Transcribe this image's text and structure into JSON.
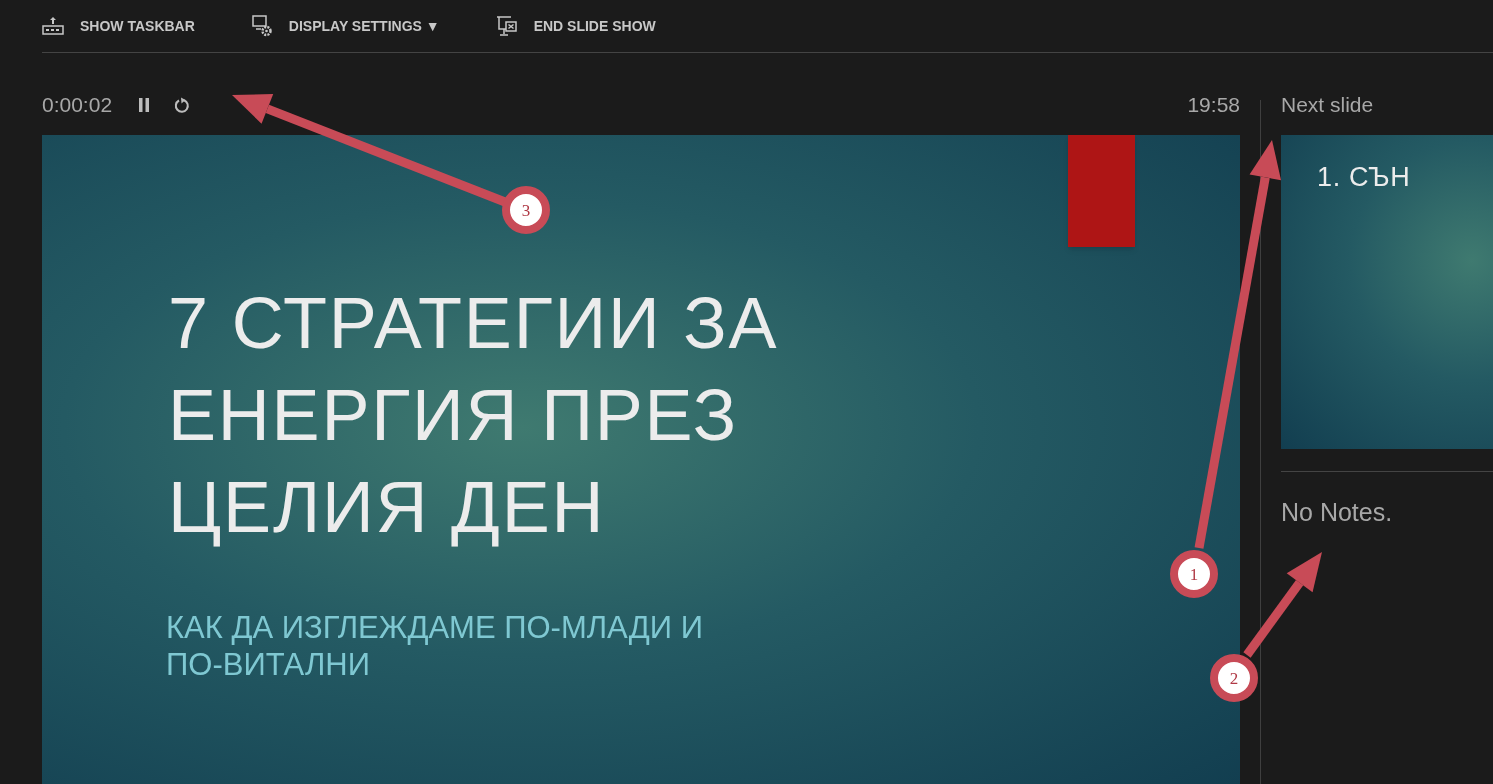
{
  "toolbar": [
    {
      "kind": "taskbar",
      "label": "SHOW TASKBAR"
    },
    {
      "kind": "display",
      "label": "DISPLAY SETTINGS ▼"
    },
    {
      "kind": "end",
      "label": "END SLIDE SHOW"
    }
  ],
  "timer": {
    "elapsed": "0:00:02",
    "clock": "19:58"
  },
  "slide": {
    "title": "7 СТРАТЕГИИ ЗА ЕНЕРГИЯ ПРЕЗ ЦЕЛИЯ ДЕН",
    "subtitle": "КАК ДА ИЗГЛЕЖДАМЕ ПО-МЛАДИ И ПО-ВИТАЛНИ"
  },
  "next_slide": {
    "heading": "Next slide",
    "preview_title": "1. СЪН"
  },
  "notes": "No Notes.",
  "annotations": [
    {
      "label": "1"
    },
    {
      "label": "2"
    },
    {
      "label": "3"
    }
  ]
}
